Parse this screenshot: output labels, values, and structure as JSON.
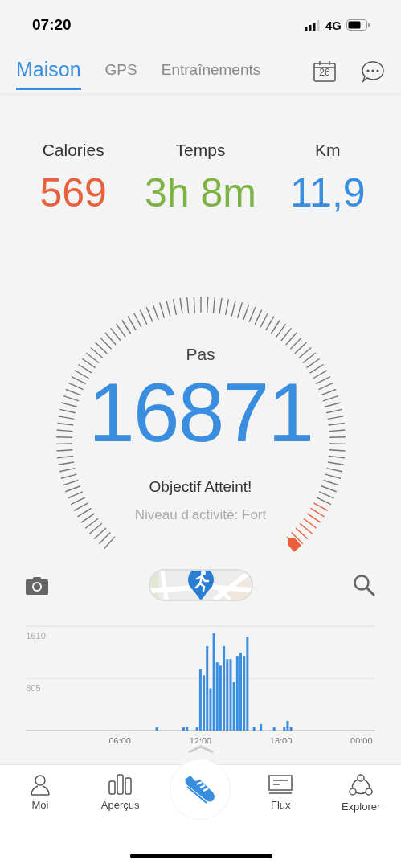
{
  "status_bar": {
    "time": "07:20",
    "network": "4G"
  },
  "tabs": [
    {
      "label": "Maison",
      "selected": true
    },
    {
      "label": "GPS",
      "selected": false
    },
    {
      "label": "Entraînements",
      "selected": false
    }
  ],
  "calendar_day": "26",
  "stats": [
    {
      "label": "Calories",
      "value": "569",
      "color": "#e8603c"
    },
    {
      "label": "Temps",
      "value": "3h 8m",
      "color": "#7cb342"
    },
    {
      "label": "Km",
      "value": "11,9",
      "color": "#3a8ee0"
    }
  ],
  "gauge": {
    "title": "Pas",
    "value": "16871",
    "status": "Objectif Atteint!",
    "activity": "Niveau d’activité: Fort"
  },
  "chart": {
    "chart_data": {
      "type": "bar",
      "x": [
        8.75,
        10.75,
        11,
        11.75,
        12,
        12.25,
        12.5,
        12.75,
        13,
        13.25,
        13.5,
        13.75,
        14,
        14.25,
        14.5,
        14.75,
        15,
        15.25,
        15.5,
        16,
        16.5,
        17.5,
        18.25,
        18.5,
        18.75,
        20.5,
        22
      ],
      "series": [
        {
          "color": "#3a8ee0",
          "values": [
            50,
            50,
            50,
            50,
            950,
            850,
            1300,
            650,
            1500,
            1050,
            1000,
            1300,
            1100,
            1100,
            750,
            1150,
            1200,
            1150,
            1450,
            50,
            100,
            50,
            50,
            150,
            50,
            0,
            0
          ]
        }
      ],
      "xlim": [
        -1,
        25
      ],
      "ylim": [
        0,
        1610
      ],
      "xticks": [
        {
          "value": 6,
          "label": "06:00"
        },
        {
          "value": 12,
          "label": "12:00"
        },
        {
          "value": 18,
          "label": "18:00"
        },
        {
          "value": 24,
          "label": "00:00"
        }
      ],
      "yticks": [
        805,
        1610
      ]
    }
  },
  "nav": [
    {
      "kind": "person",
      "label": "Moi"
    },
    {
      "kind": "bars",
      "label": "Aperçus"
    },
    {
      "kind": "shoe"
    },
    {
      "kind": "feed",
      "label": "Flux"
    },
    {
      "kind": "network",
      "label": "Explorer"
    }
  ]
}
